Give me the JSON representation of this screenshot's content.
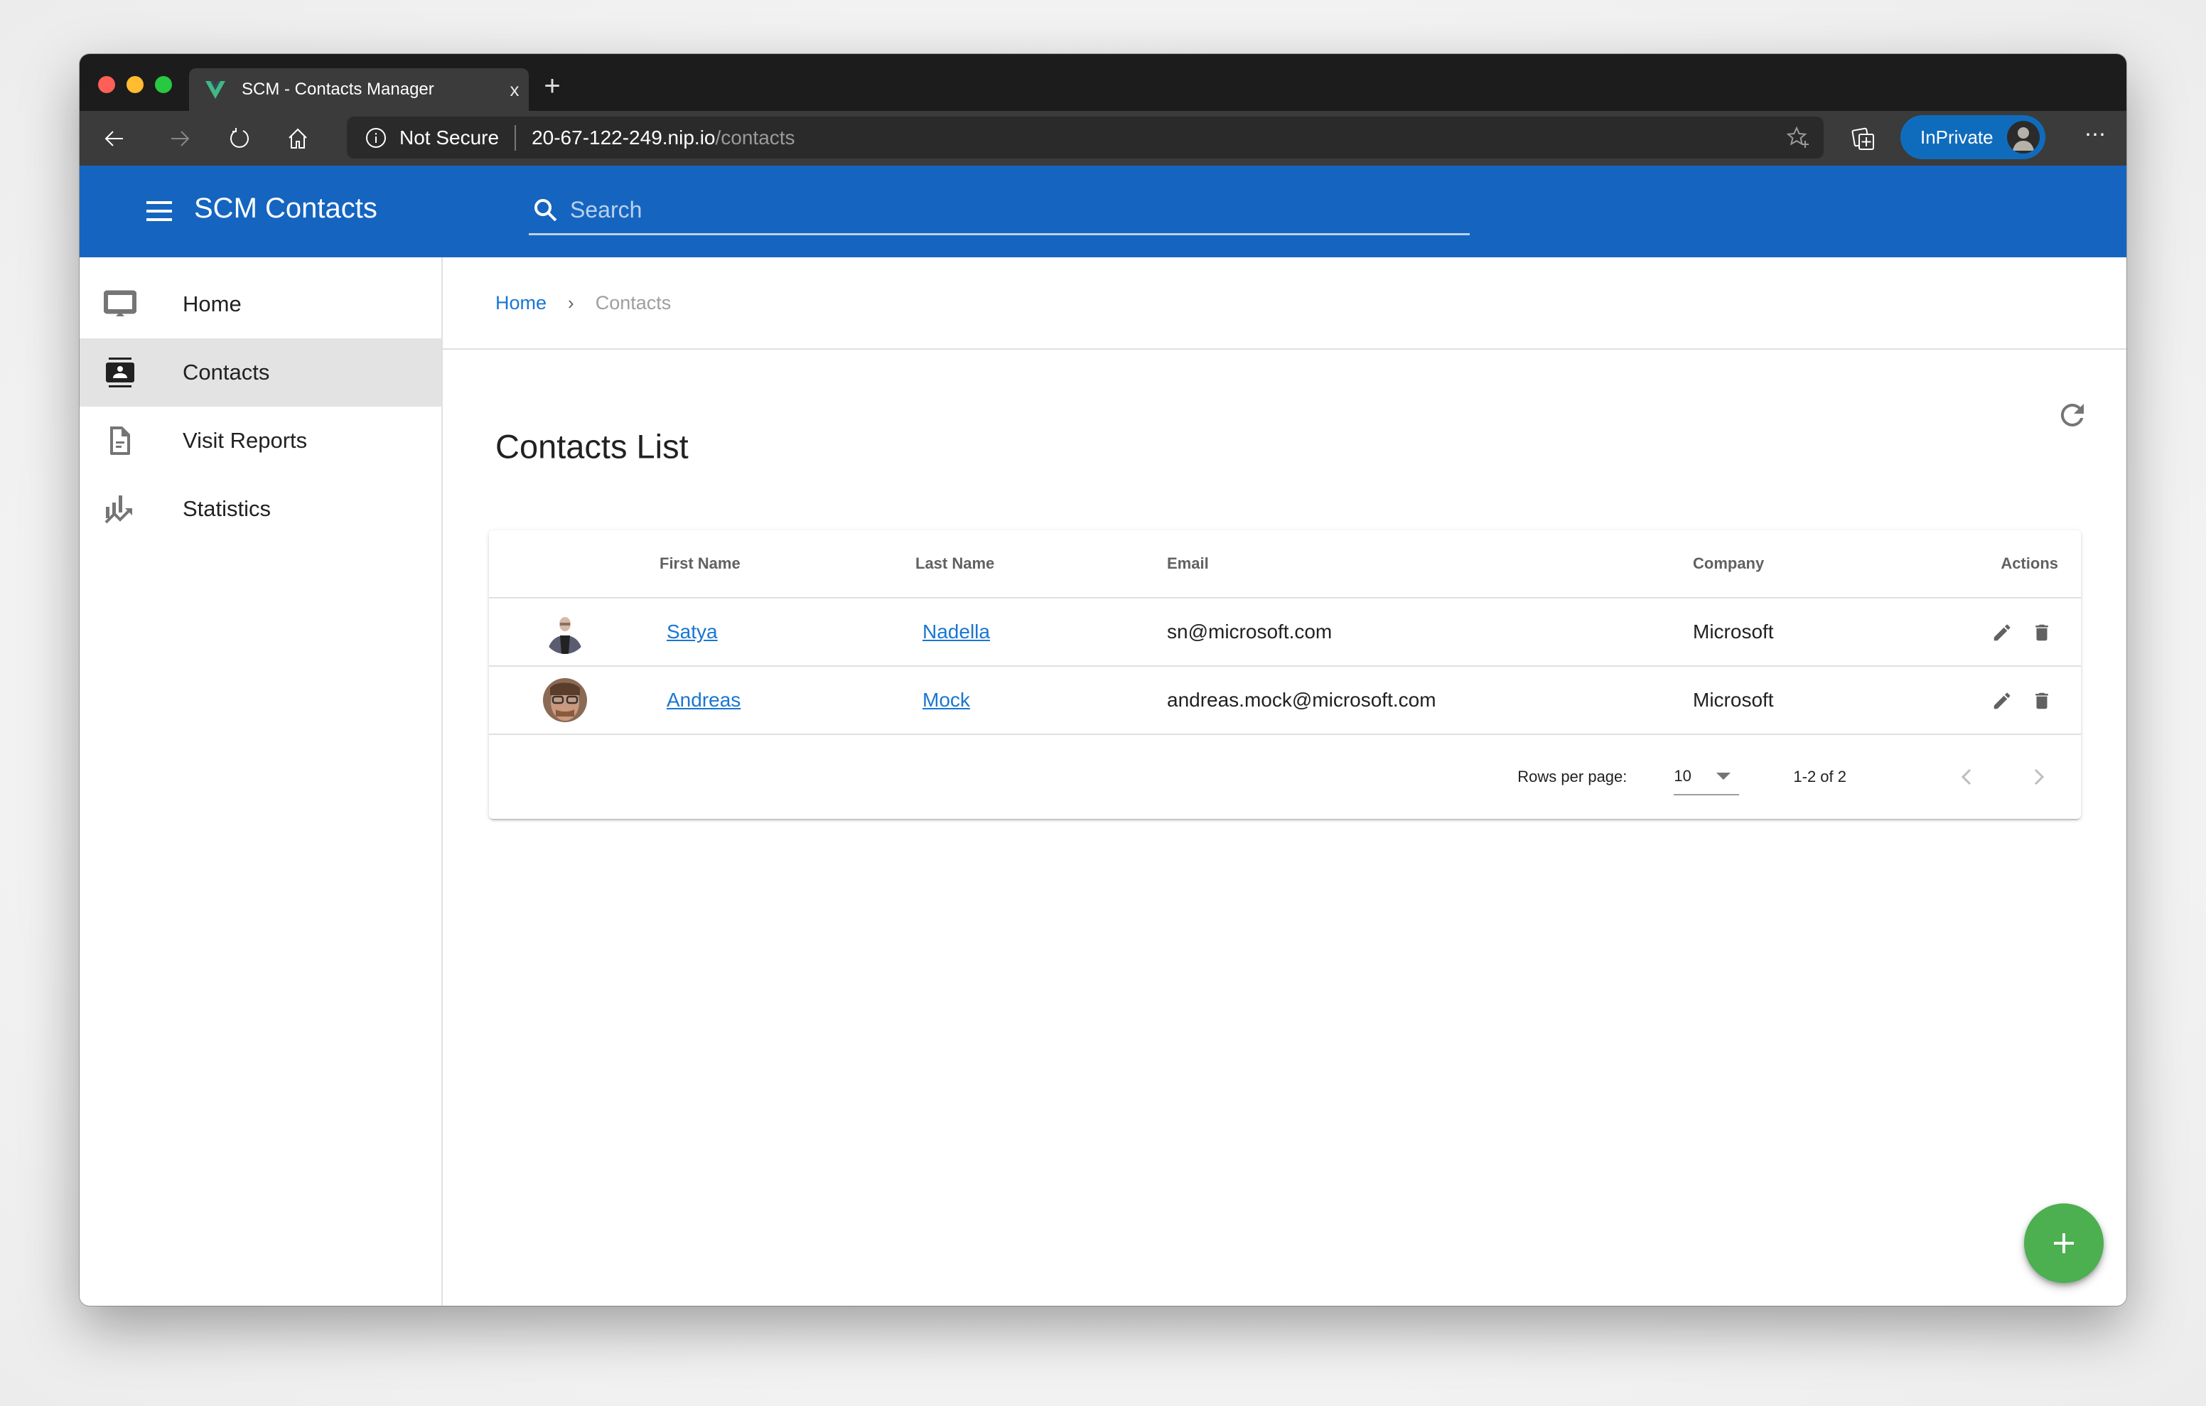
{
  "browser": {
    "tab_title": "SCM - Contacts Manager",
    "tab_close": "x",
    "new_tab": "+",
    "security_label": "Not Secure",
    "url_host": "20-67-122-249.nip.io",
    "url_path": "/contacts",
    "inprivate_label": "InPrivate",
    "more_label": "⋯",
    "favicon_color": "#41b883"
  },
  "appbar": {
    "title": "SCM Contacts",
    "search_placeholder": "Search",
    "search_value": "",
    "color": "#1565c0"
  },
  "sidebar": {
    "items": [
      {
        "label": "Home",
        "icon": "desktop-icon",
        "active": false
      },
      {
        "label": "Contacts",
        "icon": "contacts-icon",
        "active": true
      },
      {
        "label": "Visit Reports",
        "icon": "document-icon",
        "active": false
      },
      {
        "label": "Statistics",
        "icon": "chart-icon",
        "active": false
      }
    ]
  },
  "breadcrumb": {
    "home": "Home",
    "separator": "›",
    "current": "Contacts"
  },
  "page": {
    "title": "Contacts List"
  },
  "table": {
    "headers": [
      "",
      "First Name",
      "Last Name",
      "Email",
      "Company",
      "Actions"
    ],
    "rows": [
      {
        "first_name": "Satya",
        "last_name": "Nadella",
        "email": "sn@microsoft.com",
        "company": "Microsoft",
        "avatar": "photo"
      },
      {
        "first_name": "Andreas",
        "last_name": "Mock",
        "email": "andreas.mock@microsoft.com",
        "company": "Microsoft",
        "avatar": "photo"
      }
    ],
    "footer": {
      "rows_per_page_label": "Rows per page:",
      "rows_per_page_value": "10",
      "range_text": "1-2 of 2"
    }
  },
  "fab": {
    "label": "+",
    "color": "#4caf50"
  }
}
